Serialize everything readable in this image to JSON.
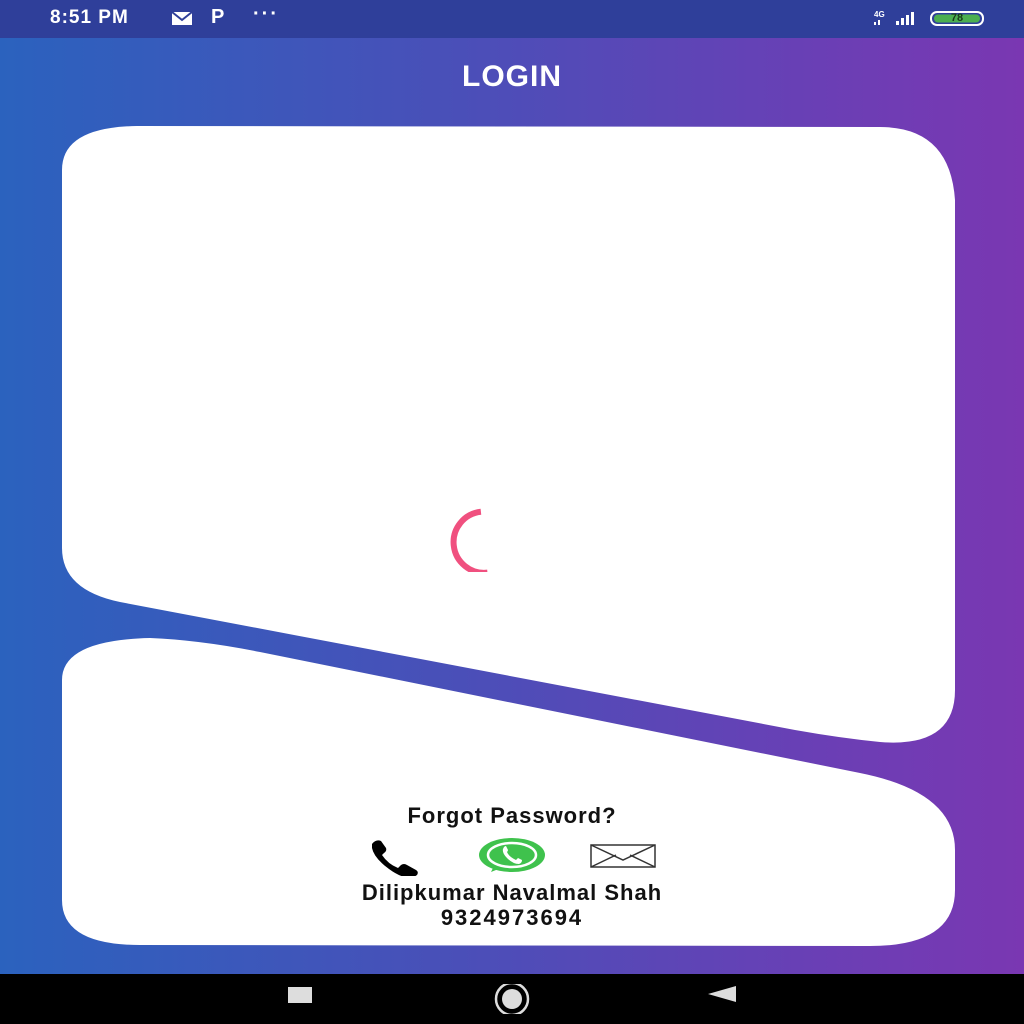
{
  "status_bar": {
    "time": "8:51 PM",
    "p_indicator": "P",
    "more_indicator": "···",
    "network_label": "4G",
    "battery_level": "78",
    "battery_color": "#4caf50"
  },
  "header": {
    "title": "LOGIN"
  },
  "loading": {
    "spinner_color": "#f0507f"
  },
  "footer": {
    "forgot_password": "Forgot Password?",
    "contact_icons": [
      "phone-icon",
      "whatsapp-icon",
      "email-icon"
    ],
    "contact_name": "Dilipkumar Navalmal Shah",
    "contact_phone": "9324973694"
  },
  "nav_bar": {
    "buttons": [
      "recent-apps-button",
      "home-button",
      "back-button"
    ]
  }
}
